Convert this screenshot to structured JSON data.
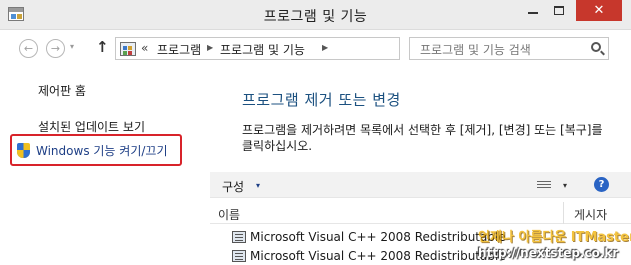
{
  "window": {
    "title": "프로그램 및 기능",
    "close_symbol": "✕"
  },
  "nav": {
    "back_symbol": "←",
    "forward_symbol": "→",
    "history_symbol": "▾",
    "up_symbol": "↑",
    "breadcrumb_overflow": "«",
    "breadcrumb": [
      "프로그램",
      "프로그램 및 기능"
    ],
    "breadcrumb_sep": "▶",
    "dropdown_symbol": "▾",
    "refresh_symbol": "↻",
    "search_placeholder": "프로그램 및 기능 검색"
  },
  "sidebar": {
    "home": "제어판 홈",
    "installed_updates": "설치된 업데이트 보기",
    "windows_features": "Windows 기능 켜기/끄기",
    "highlight_color": "#d8232a"
  },
  "main": {
    "title": "프로그램 제거 또는 변경",
    "description": "프로그램을 제거하려면 목록에서 선택한 후 [제거], [변경] 또는 [복구]를 클릭하십시오.",
    "toolbar": {
      "organize": "구성",
      "caret": "▾",
      "help": "?"
    },
    "columns": {
      "name": "이름",
      "publisher": "게시자"
    },
    "rows": [
      {
        "name": "Microsoft Visual C++ 2008 Redistributable"
      },
      {
        "name": "Microsoft Visual C++ 2008 Redistributable"
      }
    ]
  },
  "watermark": {
    "text": "언제나 아름다운 ITMaster",
    "url": "http://nextstep.co.kr"
  },
  "colors": {
    "title_blue": "#1c5180",
    "link_blue": "#1e3f86",
    "close_red": "#c7372c"
  }
}
